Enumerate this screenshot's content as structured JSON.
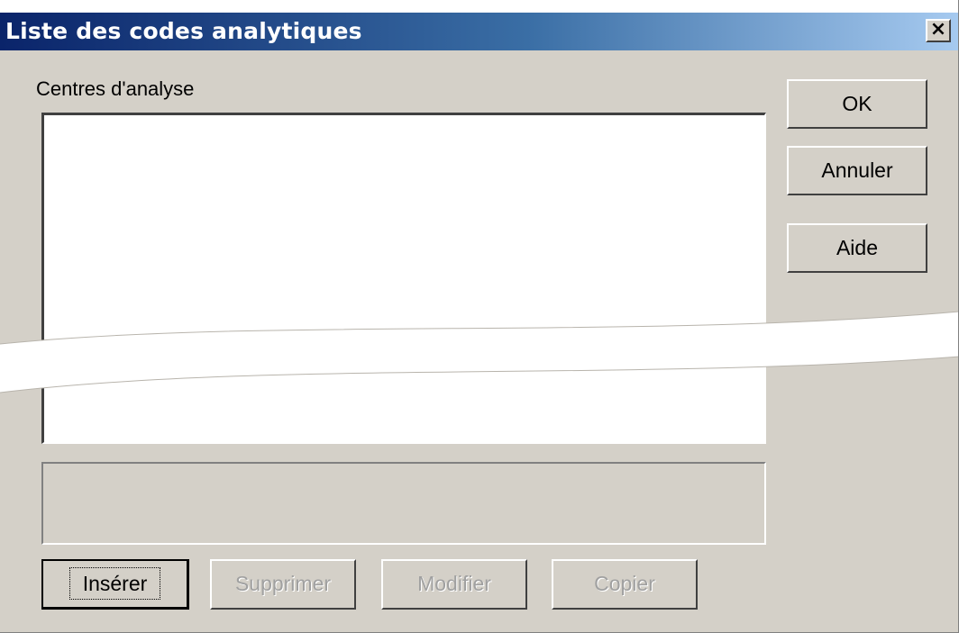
{
  "window": {
    "title": "Liste des codes analytiques",
    "close_label": "×"
  },
  "list": {
    "label": "Centres d'analyse",
    "items": []
  },
  "side_buttons": {
    "ok": "OK",
    "cancel": "Annuler",
    "help": "Aide"
  },
  "bottom_buttons": {
    "insert": "Insérer",
    "delete": "Supprimer",
    "modify": "Modifier",
    "copy": "Copier"
  },
  "colors": {
    "titlebar_start": "#0a246a",
    "titlebar_end": "#a6caf0",
    "face": "#d4d0c8"
  }
}
